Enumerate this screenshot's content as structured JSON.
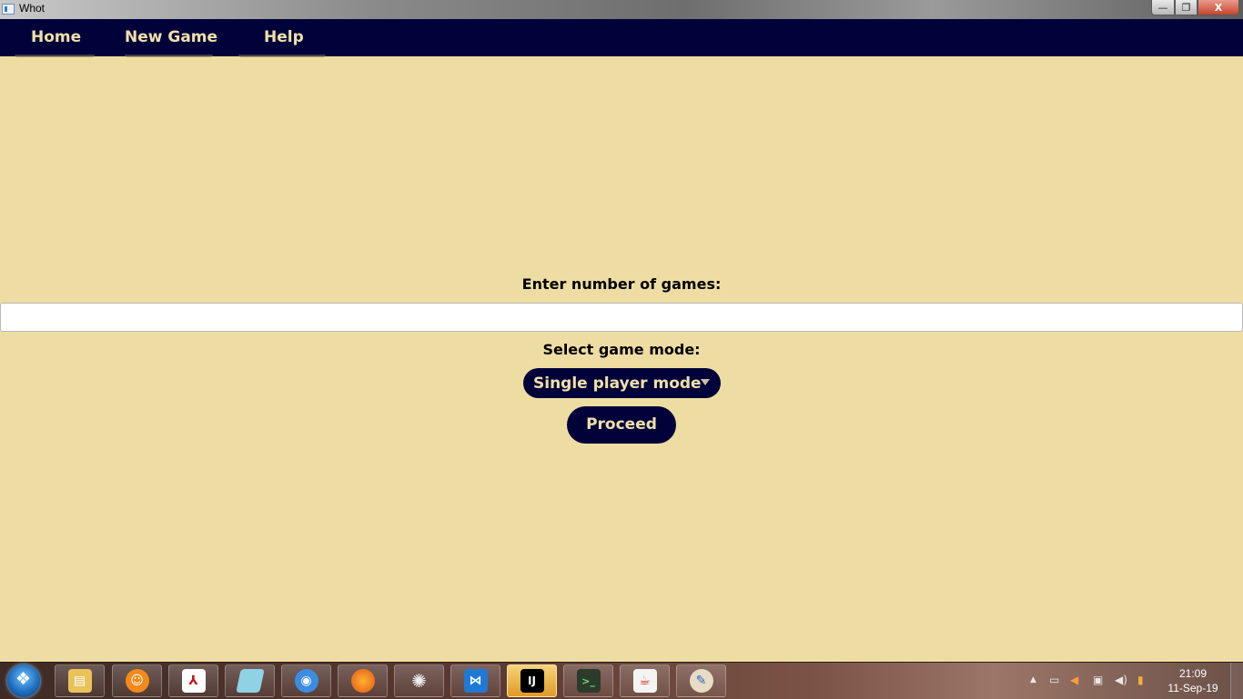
{
  "window": {
    "title": "Whot",
    "controls": {
      "minimize": "—",
      "maximize": "❐",
      "close": "X"
    }
  },
  "nav": {
    "items": [
      {
        "label": "Home"
      },
      {
        "label": "New Game"
      },
      {
        "label": "Help"
      }
    ]
  },
  "form": {
    "games_label": "Enter number of games:",
    "games_value": "",
    "games_placeholder": "",
    "mode_label": "Select game mode:",
    "mode_selected": "Single player mode",
    "proceed_label": "Proceed"
  },
  "colors": {
    "background": "#eedda2",
    "navy": "#02023a",
    "accent_text": "#efe0a8"
  },
  "taskbar": {
    "apps": [
      {
        "icon": "file-explorer-icon"
      },
      {
        "icon": "uc-browser-icon"
      },
      {
        "icon": "adobe-reader-icon"
      },
      {
        "icon": "notepad-icon"
      },
      {
        "icon": "network-globe-icon"
      },
      {
        "icon": "firefox-icon"
      },
      {
        "icon": "spider-app-icon"
      },
      {
        "icon": "visual-studio-code-icon"
      },
      {
        "icon": "intellij-idea-icon",
        "active": true
      },
      {
        "icon": "terminal-icon"
      },
      {
        "icon": "java-icon"
      },
      {
        "icon": "paint-icon"
      }
    ],
    "clock": {
      "time": "21:09",
      "date": "11-Sep-19"
    }
  }
}
